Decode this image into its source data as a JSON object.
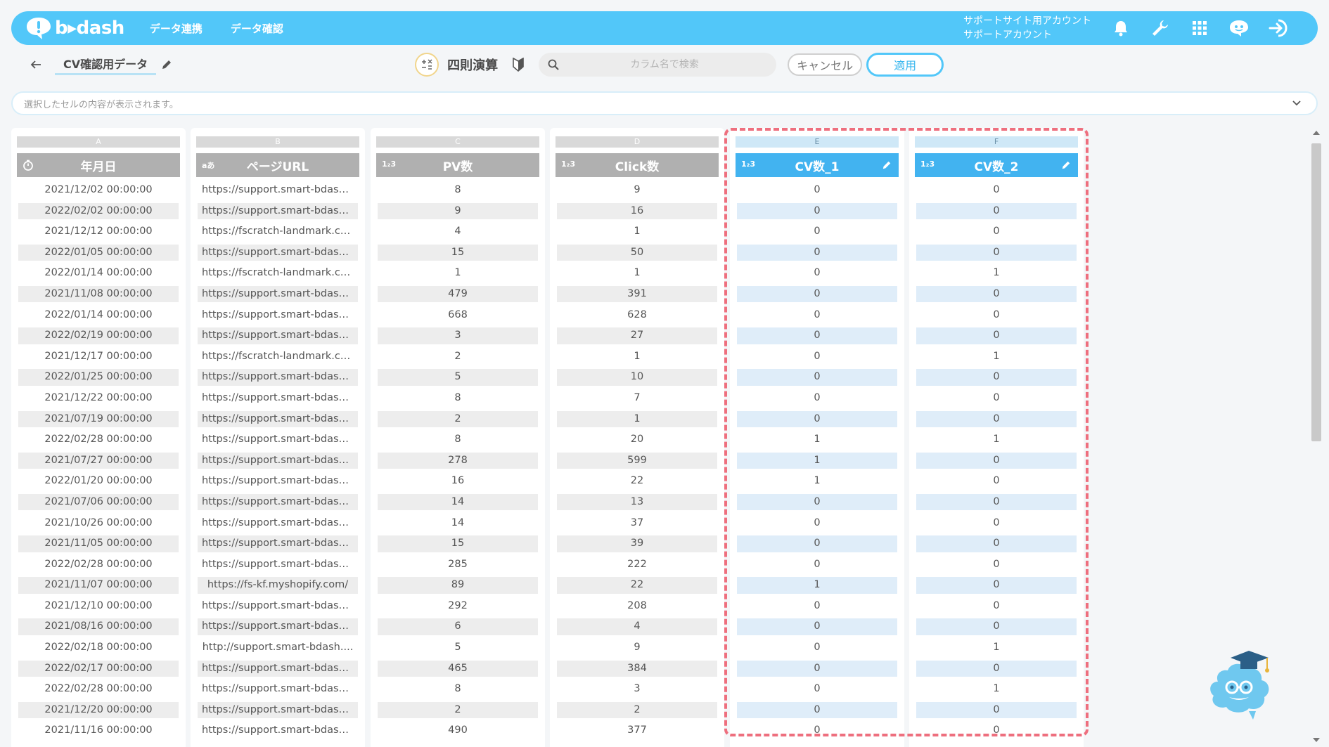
{
  "header": {
    "logo_text": "b▸dash",
    "nav": [
      "データ連携",
      "データ確認"
    ],
    "account_line1": "サポートサイト用アカウント",
    "account_line2": "サポートアカウント",
    "icons": [
      "bell-icon",
      "wrench-icon",
      "grid-icon",
      "support-chat-icon",
      "logout-icon"
    ],
    "accent_color": "#52c7f9"
  },
  "toolbar": {
    "dataset_name": "CV確認用データ",
    "operation_label": "四則演算",
    "search_placeholder": "カラム名で検索",
    "cancel_label": "キャンセル",
    "apply_label": "適用"
  },
  "cell_preview": {
    "placeholder": "選択したセルの内容が表示されます。"
  },
  "columns": [
    {
      "letter": "A",
      "name": "年月日",
      "type": "datetime",
      "selected": false,
      "cells": [
        "2021/12/02 00:00:00",
        "2022/02/02 00:00:00",
        "2021/12/12 00:00:00",
        "2022/01/05 00:00:00",
        "2022/01/14 00:00:00",
        "2021/11/08 00:00:00",
        "2022/01/14 00:00:00",
        "2022/02/19 00:00:00",
        "2021/12/17 00:00:00",
        "2022/01/25 00:00:00",
        "2021/12/22 00:00:00",
        "2021/07/19 00:00:00",
        "2022/02/28 00:00:00",
        "2021/07/27 00:00:00",
        "2022/01/20 00:00:00",
        "2021/07/06 00:00:00",
        "2021/10/26 00:00:00",
        "2021/11/05 00:00:00",
        "2022/02/28 00:00:00",
        "2021/11/07 00:00:00",
        "2021/12/10 00:00:00",
        "2021/08/16 00:00:00",
        "2022/02/18 00:00:00",
        "2022/02/17 00:00:00",
        "2022/02/28 00:00:00",
        "2021/12/20 00:00:00",
        "2021/11/16 00:00:00"
      ]
    },
    {
      "letter": "B",
      "name": "ページURL",
      "type": "text",
      "type_label": "aあ",
      "selected": false,
      "cells": [
        "https://support.smart-bdash...",
        "https://support.smart-bdash...",
        "https://fscratch-landmark.co...",
        "https://support.smart-bdash...",
        "https://fscratch-landmark.co...",
        "https://support.smart-bdash...",
        "https://support.smart-bdash...",
        "https://support.smart-bdash...",
        "https://fscratch-landmark.co...",
        "https://support.smart-bdash...",
        "https://support.smart-bdash...",
        "https://support.smart-bdash...",
        "https://support.smart-bdash...",
        "https://support.smart-bdash...",
        "https://support.smart-bdash...",
        "https://support.smart-bdash...",
        "https://support.smart-bdash...",
        "https://support.smart-bdash...",
        "https://support.smart-bdash...",
        "https://fs-kf.myshopify.com/",
        "https://support.smart-bdash...",
        "https://support.smart-bdash...",
        "http://support.smart-bdash....",
        "https://support.smart-bdash...",
        "https://support.smart-bdash...",
        "https://support.smart-bdash...",
        "https://support.smart-bdash..."
      ]
    },
    {
      "letter": "C",
      "name": "PV数",
      "type": "number",
      "type_label": "1₂3",
      "selected": false,
      "cells": [
        "8",
        "9",
        "4",
        "15",
        "1",
        "479",
        "668",
        "3",
        "2",
        "5",
        "8",
        "2",
        "8",
        "278",
        "16",
        "14",
        "14",
        "15",
        "285",
        "89",
        "292",
        "6",
        "5",
        "465",
        "8",
        "2",
        "490"
      ]
    },
    {
      "letter": "D",
      "name": "Click数",
      "type": "number",
      "type_label": "1₂3",
      "selected": false,
      "cells": [
        "9",
        "16",
        "1",
        "50",
        "1",
        "391",
        "628",
        "27",
        "1",
        "10",
        "7",
        "1",
        "20",
        "599",
        "22",
        "13",
        "37",
        "39",
        "222",
        "22",
        "208",
        "4",
        "9",
        "384",
        "3",
        "2",
        "377"
      ]
    },
    {
      "letter": "E",
      "name": "CV数_1",
      "type": "number",
      "type_label": "1₂3",
      "selected": true,
      "cells": [
        "0",
        "0",
        "0",
        "0",
        "0",
        "0",
        "0",
        "0",
        "0",
        "0",
        "0",
        "0",
        "1",
        "1",
        "1",
        "0",
        "0",
        "0",
        "0",
        "1",
        "0",
        "0",
        "0",
        "0",
        "0",
        "0",
        "0"
      ]
    },
    {
      "letter": "F",
      "name": "CV数_2",
      "type": "number",
      "type_label": "1₂3",
      "selected": true,
      "cells": [
        "0",
        "0",
        "0",
        "0",
        "1",
        "0",
        "0",
        "0",
        "1",
        "0",
        "0",
        "0",
        "1",
        "0",
        "0",
        "0",
        "0",
        "0",
        "0",
        "0",
        "0",
        "0",
        "1",
        "0",
        "1",
        "0",
        "0"
      ]
    }
  ]
}
